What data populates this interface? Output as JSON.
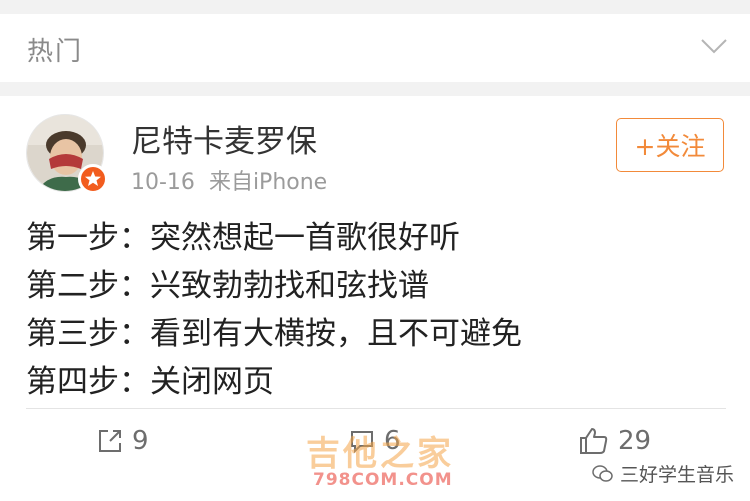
{
  "header": {
    "title": "热门"
  },
  "post": {
    "author": "尼特卡麦罗保",
    "date": "10-16",
    "source": "来自iPhone",
    "follow_label": "+关注",
    "lines": [
      "第一步：突然想起一首歌很好听",
      "第二步：兴致勃勃找和弦找谱",
      "第三步：看到有大横按，且不可避免",
      "第四步：关闭网页"
    ]
  },
  "actions": {
    "repost_count": "9",
    "comment_count": "6",
    "like_count": "29"
  },
  "watermarks": {
    "main": "吉他之家",
    "sub": "798COM.COM",
    "wechat": "三好学生音乐"
  },
  "colors": {
    "accent": "#f28a3a",
    "verified_badge": "#f25c1e",
    "text": "#222222",
    "meta": "#9b9b9b"
  },
  "icons": {
    "collapse": "chevron-down-icon",
    "repost": "repost-icon",
    "comment": "comment-icon",
    "like": "thumbs-up-icon",
    "verified": "verified-badge-icon",
    "wechat": "wechat-icon"
  }
}
